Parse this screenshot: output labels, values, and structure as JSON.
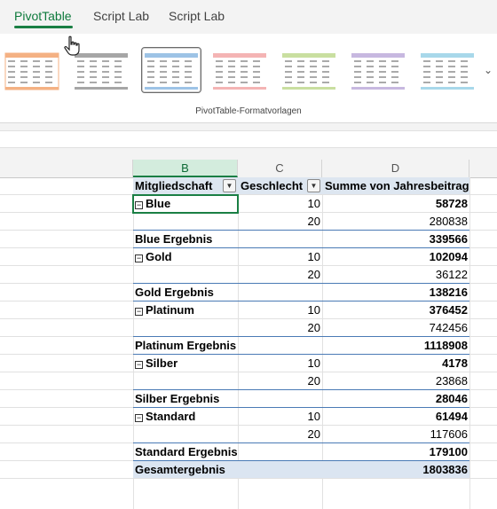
{
  "tabs": [
    {
      "label": "PivotTable",
      "active": true
    },
    {
      "label": "Script Lab",
      "active": false
    },
    {
      "label": "Script Lab",
      "active": false
    }
  ],
  "ribbon": {
    "group_label": "PivotTable-Formatvorlagen",
    "style_colors": [
      "#f4b183",
      "#a6a6a6",
      "#9dc3e6",
      "#f4b4b4",
      "#c9dfa0",
      "#c7b8e0",
      "#a8d8ea"
    ]
  },
  "columns": [
    "B",
    "C",
    "D"
  ],
  "pivot": {
    "headers": {
      "b": "Mitgliedschaft",
      "c": "Geschlecht",
      "d": "Summe von Jahresbeitrag"
    },
    "rows": [
      {
        "type": "group",
        "b": "Blue",
        "c": "10",
        "d": "58728"
      },
      {
        "type": "item",
        "b": "",
        "c": "20",
        "d": "280838"
      },
      {
        "type": "subtotal",
        "b": "Blue Ergebnis",
        "c": "",
        "d": "339566"
      },
      {
        "type": "group",
        "b": "Gold",
        "c": "10",
        "d": "102094"
      },
      {
        "type": "item",
        "b": "",
        "c": "20",
        "d": "36122"
      },
      {
        "type": "subtotal",
        "b": "Gold Ergebnis",
        "c": "",
        "d": "138216"
      },
      {
        "type": "group",
        "b": "Platinum",
        "c": "10",
        "d": "376452"
      },
      {
        "type": "item",
        "b": "",
        "c": "20",
        "d": "742456"
      },
      {
        "type": "subtotal",
        "b": "Platinum Ergebnis",
        "c": "",
        "d": "1118908"
      },
      {
        "type": "group",
        "b": "Silber",
        "c": "10",
        "d": "4178"
      },
      {
        "type": "item",
        "b": "",
        "c": "20",
        "d": "23868"
      },
      {
        "type": "subtotal",
        "b": "Silber Ergebnis",
        "c": "",
        "d": "28046"
      },
      {
        "type": "group",
        "b": "Standard",
        "c": "10",
        "d": "61494"
      },
      {
        "type": "item",
        "b": "",
        "c": "20",
        "d": "117606"
      },
      {
        "type": "subtotal",
        "b": "Standard Ergebnis",
        "c": "",
        "d": "179100"
      },
      {
        "type": "grandtotal",
        "b": "Gesamtergebnis",
        "c": "",
        "d": "1803836"
      }
    ]
  }
}
